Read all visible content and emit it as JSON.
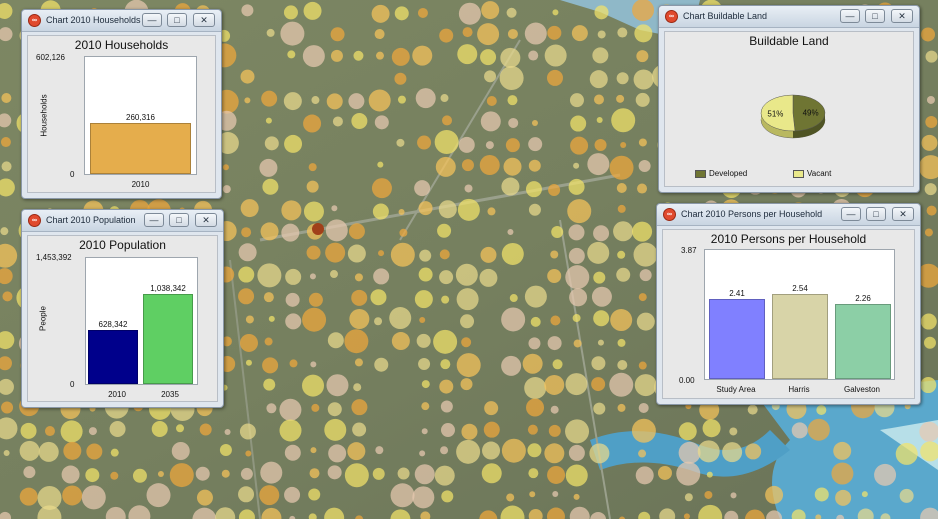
{
  "colors": {
    "households_bar": "#e5ad4c",
    "pop_2010": "#00008b",
    "pop_2035": "#5fcf63",
    "pph_study_area": "#8080ff",
    "pph_harris": "#d8d4a8",
    "pph_galveston": "#8ccfa6",
    "developed": "#6f7533",
    "vacant": "#e9e88a"
  },
  "windows": {
    "households": {
      "title": "Chart 2010 Households"
    },
    "population": {
      "title": "Chart 2010 Population"
    },
    "buildable": {
      "title": "Chart Buildable Land"
    },
    "pph": {
      "title": "Chart 2010 Persons per Household"
    }
  },
  "chart_data": [
    {
      "id": "households",
      "type": "bar",
      "title": "2010 Households",
      "ylabel": "Households",
      "ylim": [
        0,
        602126
      ],
      "yticks": [
        "602,126",
        "0"
      ],
      "categories": [
        "2010"
      ],
      "values": [
        260316
      ],
      "value_labels": [
        "260,316"
      ],
      "grid": false
    },
    {
      "id": "population",
      "type": "bar",
      "title": "2010 Population",
      "ylabel": "People",
      "ylim": [
        0,
        1453392
      ],
      "yticks": [
        "1,453,392",
        "0"
      ],
      "categories": [
        "2010",
        "2035"
      ],
      "values": [
        628342,
        1038342
      ],
      "value_labels": [
        "628,342",
        "1,038,342"
      ],
      "grid": false
    },
    {
      "id": "buildable",
      "type": "pie",
      "title": "Buildable Land",
      "slices": [
        {
          "name": "Developed",
          "value": 49,
          "label": "49%"
        },
        {
          "name": "Vacant",
          "value": 51,
          "label": "51%"
        }
      ],
      "legend": "bottom"
    },
    {
      "id": "pph",
      "type": "bar",
      "title": "2010 Persons per Household",
      "ylim": [
        0,
        3.87
      ],
      "yticks": [
        "3.87",
        "0.00"
      ],
      "categories": [
        "Study Area",
        "Harris",
        "Galveston"
      ],
      "values": [
        2.41,
        2.54,
        2.26
      ],
      "value_labels": [
        "2.41",
        "2.54",
        "2.26"
      ],
      "grid": false
    }
  ]
}
